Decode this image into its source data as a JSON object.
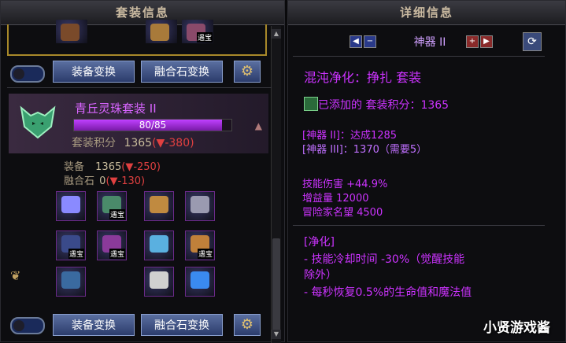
{
  "left_panel": {
    "title": "套装信息",
    "top_items": [
      {
        "icon": "armor-piece-icon",
        "tag": ""
      },
      {
        "icon": "armor-piece-icon",
        "tag": ""
      },
      {
        "icon": "treasure-icon",
        "tag": "遇宝"
      }
    ],
    "buttons": {
      "equip_switch": "装备变换",
      "fusion_switch": "融合石变换"
    },
    "set": {
      "name": "青丘灵珠套装 II",
      "progress_text": "80/85",
      "progress": 0.941,
      "score_label": "套装积分",
      "score_value": "1365",
      "score_delta": "-380",
      "equip_label": "装备",
      "equip_value": "1365",
      "equip_delta": "-250",
      "fusion_label": "融合石",
      "fusion_value": "0",
      "fusion_delta": "-130"
    },
    "equip_grid": [
      {
        "tag": "",
        "color": "#8a8aff"
      },
      {
        "tag": "遇宝",
        "color": "#4a8a6a"
      },
      {
        "tag": "",
        "color": "#c08a40"
      },
      {
        "tag": "",
        "color": "#9a9ab0"
      },
      {
        "tag": "遇宝",
        "color": "#3a4a8a"
      },
      {
        "tag": "遇宝",
        "color": "#8a3a9a"
      },
      {
        "tag": "",
        "color": "#5ab0e0"
      },
      {
        "tag": "遇宝",
        "color": "#c0803a"
      },
      {
        "tag": "",
        "color": "#3a6aa0"
      },
      {
        "tag": "",
        "color": "#d0d0d0"
      },
      {
        "tag": "",
        "color": "#3a8af0"
      }
    ]
  },
  "right_panel": {
    "title": "详细信息",
    "nav_label": "神器 II",
    "set_title": "混沌净化：挣扎 套装",
    "added_label": "已添加的 套装积分：1365",
    "tiers": [
      "[神器 II]：达成1285",
      "[神器 III]：1370（需要5）"
    ],
    "stats": [
      "技能伤害 +44.9%",
      "增益量 12000",
      "冒险家名望 4500"
    ],
    "effect_title": "[净化]",
    "effect_lines": [
      "- 技能冷却时间 -30%（觉醒技能",
      "除外）",
      "- 每秒恢复0.5%的生命值和魔法值"
    ]
  },
  "watermark": "小贤游戏酱"
}
